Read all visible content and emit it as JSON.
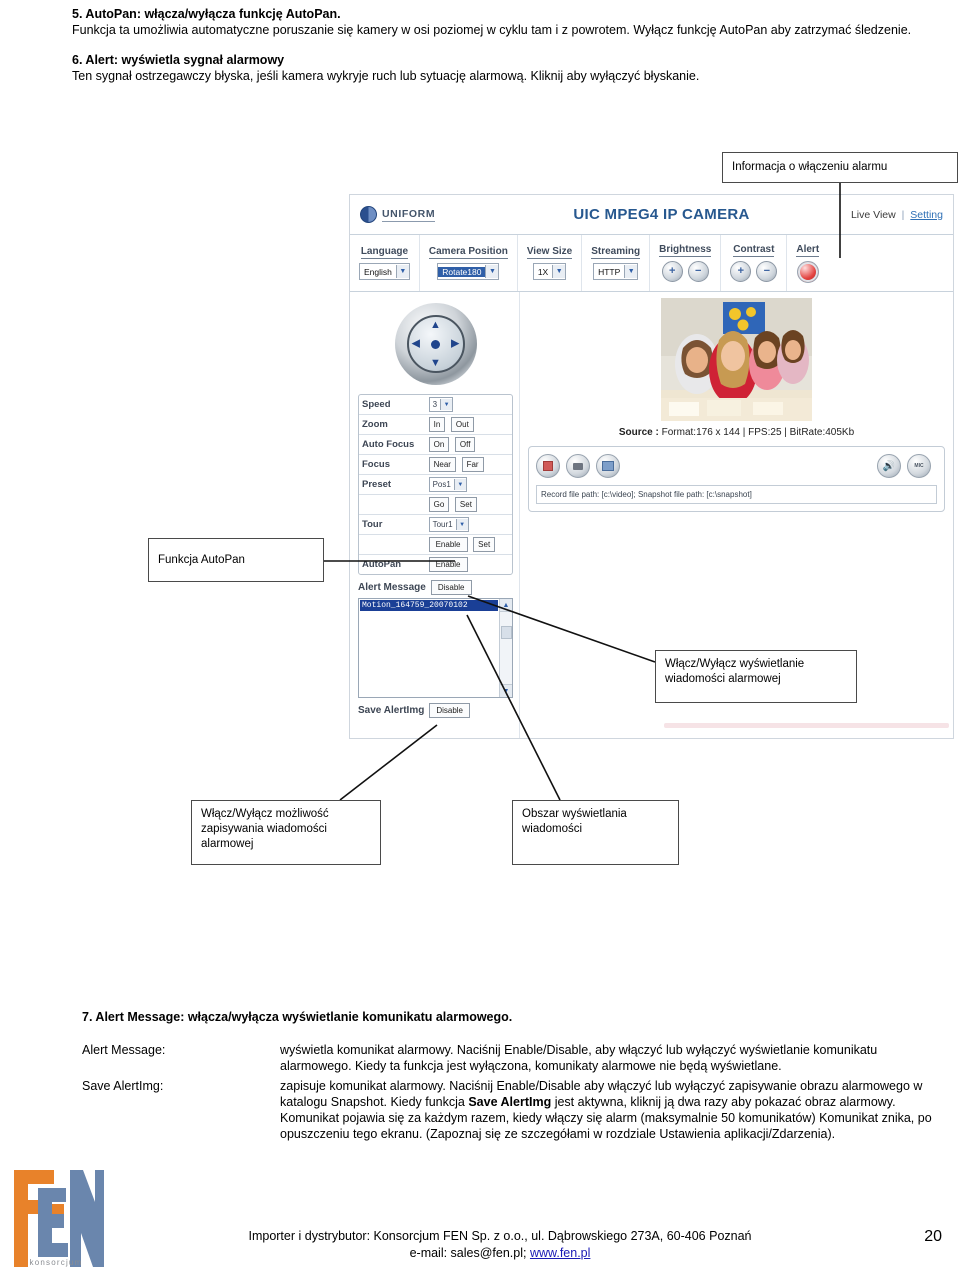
{
  "section5": {
    "heading": "5. AutoPan: włącza/wyłącza funkcję AutoPan.",
    "body": "Funkcja ta umożliwia automatyczne poruszanie się kamery w osi poziomej w cyklu tam i z powrotem. Wyłącz funkcję AutoPan aby zatrzymać śledzenie."
  },
  "section6": {
    "heading": "6. Alert: wyświetla sygnał alarmowy",
    "body": "Ten sygnał ostrzegawczy błyska, jeśli kamera wykryje ruch lub sytuację alarmową. Kliknij aby wyłączyć błyskanie."
  },
  "screenshot": {
    "brand": "UNIFORM",
    "title": "UIC MPEG4 IP CAMERA",
    "nav": {
      "live_view": "Live View",
      "separator": "|",
      "setting": "Setting"
    },
    "controls": [
      {
        "label": "Language",
        "type": "select",
        "value": "English",
        "highlighted": false
      },
      {
        "label": "Camera Position",
        "type": "select",
        "value": "Rotate180",
        "highlighted": true
      },
      {
        "label": "View Size",
        "type": "select",
        "value": "1X",
        "highlighted": false
      },
      {
        "label": "Streaming",
        "type": "select",
        "value": "HTTP",
        "highlighted": false
      },
      {
        "label": "Brightness",
        "type": "plusminus",
        "plus": "+",
        "minus": "−"
      },
      {
        "label": "Contrast",
        "type": "plusminus",
        "plus": "+",
        "minus": "−"
      },
      {
        "label": "Alert",
        "type": "led"
      }
    ],
    "ptz_rows": [
      {
        "label": "Speed",
        "kind": "select",
        "value": "3"
      },
      {
        "label": "Zoom",
        "kind": "buttons",
        "buttons": [
          "In",
          "Out"
        ]
      },
      {
        "label": "Auto Focus",
        "kind": "buttons",
        "buttons": [
          "On",
          "Off"
        ]
      },
      {
        "label": "Focus",
        "kind": "buttons",
        "buttons": [
          "Near",
          "Far"
        ]
      },
      {
        "label": "Preset",
        "kind": "select",
        "value": "Pos1"
      },
      {
        "label": "",
        "kind": "buttons",
        "buttons": [
          "Go",
          "Set"
        ]
      },
      {
        "label": "Tour",
        "kind": "select",
        "value": "Tour1"
      },
      {
        "label": "",
        "kind": "buttons",
        "buttons": [
          "Enable",
          "Set"
        ]
      },
      {
        "label": "AutoPan",
        "kind": "buttons",
        "buttons": [
          "Enable"
        ]
      }
    ],
    "alert_message": {
      "label": "Alert Message",
      "button": "Disable",
      "selected_item": "Motion_164759_20070102"
    },
    "save_alert_img": {
      "label": "Save AlertImg",
      "button": "Disable"
    },
    "source_line": {
      "prefix": "Source :",
      "text": " Format:176 x 144 | FPS:25 | BitRate:405Kb"
    },
    "media_buttons": [
      "rec-button",
      "snapshot-button",
      "path-button",
      "speaker-button",
      "mic-button"
    ],
    "media_button_labels": {
      "rec": "REC",
      "path": "PATH",
      "mic": "MIC"
    },
    "path_bar": "Record file path: [c:\\video]; Snapshot file path: [c:\\snapshot]"
  },
  "callouts": {
    "alarm_info": "Informacja o włączeniu alarmu",
    "autopan": "Funkcja AutoPan",
    "toggle_display": "Włącz/Wyłącz wyświetlanie wiadomości alarmowej",
    "toggle_save": "Włącz/Wyłącz możliwość zapisywania wiadomości alarmowej",
    "message_area": "Obszar wyświetlania wiadomości"
  },
  "section7": {
    "heading": "7. Alert Message: włącza/wyłącza wyświetlanie komunikatu alarmowego.",
    "items": [
      {
        "term": "Alert Message:",
        "desc": "wyświetla komunikat alarmowy. Naciśnij Enable/Disable, aby włączyć lub wyłączyć wyświetlanie komunikatu alarmowego. Kiedy ta funkcja jest wyłączona, komunikaty alarmowe nie będą wyświetlane."
      },
      {
        "term": "Save AlertImg:",
        "desc_1": "zapisuje komunikat alarmowy. Naciśnij Enable/Disable aby włączyć lub wyłączyć zapisywanie obrazu alarmowego w katalogu Snapshot. Kiedy funkcja ",
        "desc_bold": "Save AlertImg",
        "desc_2": " jest aktywna, kliknij ją dwa razy aby pokazać obraz alarmowy. Komunikat pojawia się za każdym razem, kiedy włączy się alarm (maksymalnie 50 komunikatów) Komunikat znika, po opuszczeniu tego ekranu. (Zapoznaj się ze szczegółami w rozdziale Ustawienia aplikacji/Zdarzenia)."
      }
    ]
  },
  "footer": {
    "logo_text": "konsorcjum",
    "line1": "Importer i dystrybutor: Konsorcjum FEN Sp. z o.o., ul. Dąbrowskiego 273A, 60-406 Poznań",
    "line2_prefix": "e-mail: sales@fen.pl; ",
    "line2_link": "www.fen.pl",
    "page_number": "20"
  },
  "colors": {
    "brand_blue": "#27588f",
    "logo_orange": "#e8822a",
    "logo_blue": "#6a86ad",
    "link_blue": "#1a1ab5",
    "selection_blue": "#1a3f96"
  }
}
